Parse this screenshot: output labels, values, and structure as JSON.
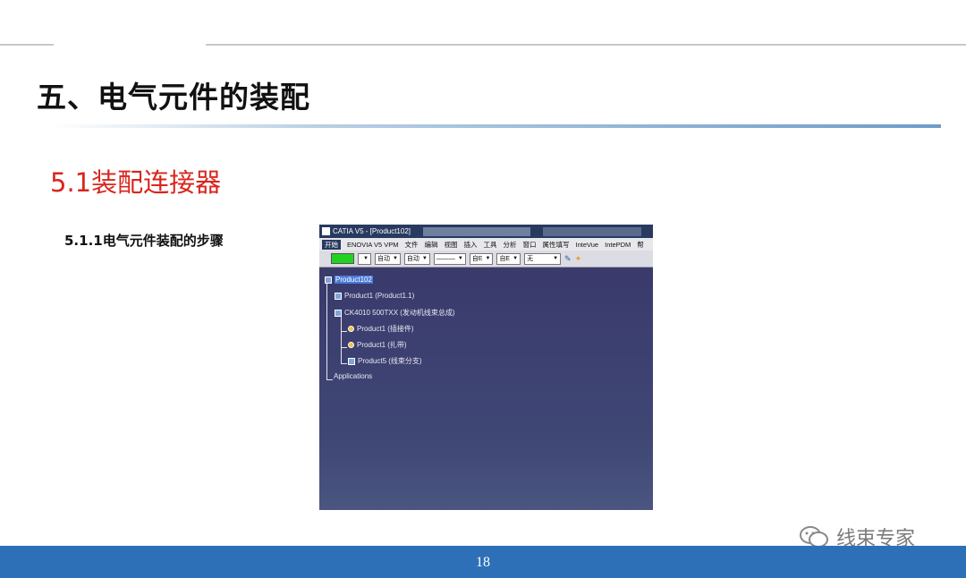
{
  "slide": {
    "title": "五、电气元件的装配",
    "subtitle": "5.1装配连接器",
    "step": "5.1.1电气元件装配的步骤",
    "page_number": "18",
    "watermark": "线束专家",
    "colors": {
      "subtitle": "#d9251d",
      "footer": "#2e70b8",
      "accent_rule": "#6e9cc8"
    }
  },
  "catia": {
    "window_title": "CATIA V5 - [Product102]",
    "menu": [
      "开始",
      "ENOVIA V5 VPM",
      "文件",
      "编辑",
      "视图",
      "插入",
      "工具",
      "分析",
      "窗口",
      "属性填写",
      "InteVue",
      "IntePDM",
      "帮"
    ],
    "toolbar": {
      "color_swatch": "#21d321",
      "combo1": "自动",
      "combo2": "自动",
      "combo3": "———",
      "combo4": "自E",
      "combo5": "自E",
      "combo6": "无"
    },
    "tree": [
      {
        "label": "Product102",
        "icon": "product-icon"
      },
      {
        "label": "Product1 (Product1.1)",
        "icon": "product-icon"
      },
      {
        "label": "CK4010 500TXX (发动机线束总成)",
        "icon": "product-icon"
      },
      {
        "label": "Product1 (插接件)",
        "icon": "part-icon"
      },
      {
        "label": "Product1 (扎带)",
        "icon": "part-icon"
      },
      {
        "label": "Product5 (线束分支)",
        "icon": "product-icon"
      },
      {
        "label": "Applications",
        "icon": ""
      }
    ]
  }
}
